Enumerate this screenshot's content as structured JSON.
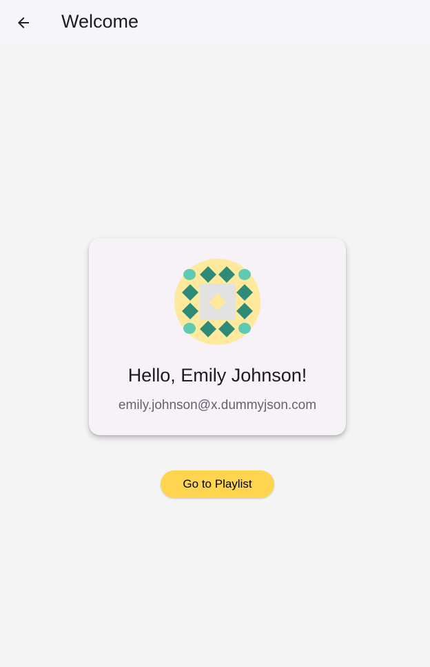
{
  "app_bar": {
    "title": "Welcome"
  },
  "profile": {
    "greeting": "Hello, Emily Johnson!",
    "email": "emily.johnson@x.dummyjson.com"
  },
  "actions": {
    "playlist_label": "Go to Playlist"
  },
  "icons": {
    "back": "back-arrow-icon",
    "avatar": "geometric-pattern-avatar"
  },
  "colors": {
    "button": "#ffd54f",
    "avatar_bg": "#ffe99d",
    "avatar_shapes": "#2e8b78",
    "avatar_accents": "#5ecab2"
  }
}
